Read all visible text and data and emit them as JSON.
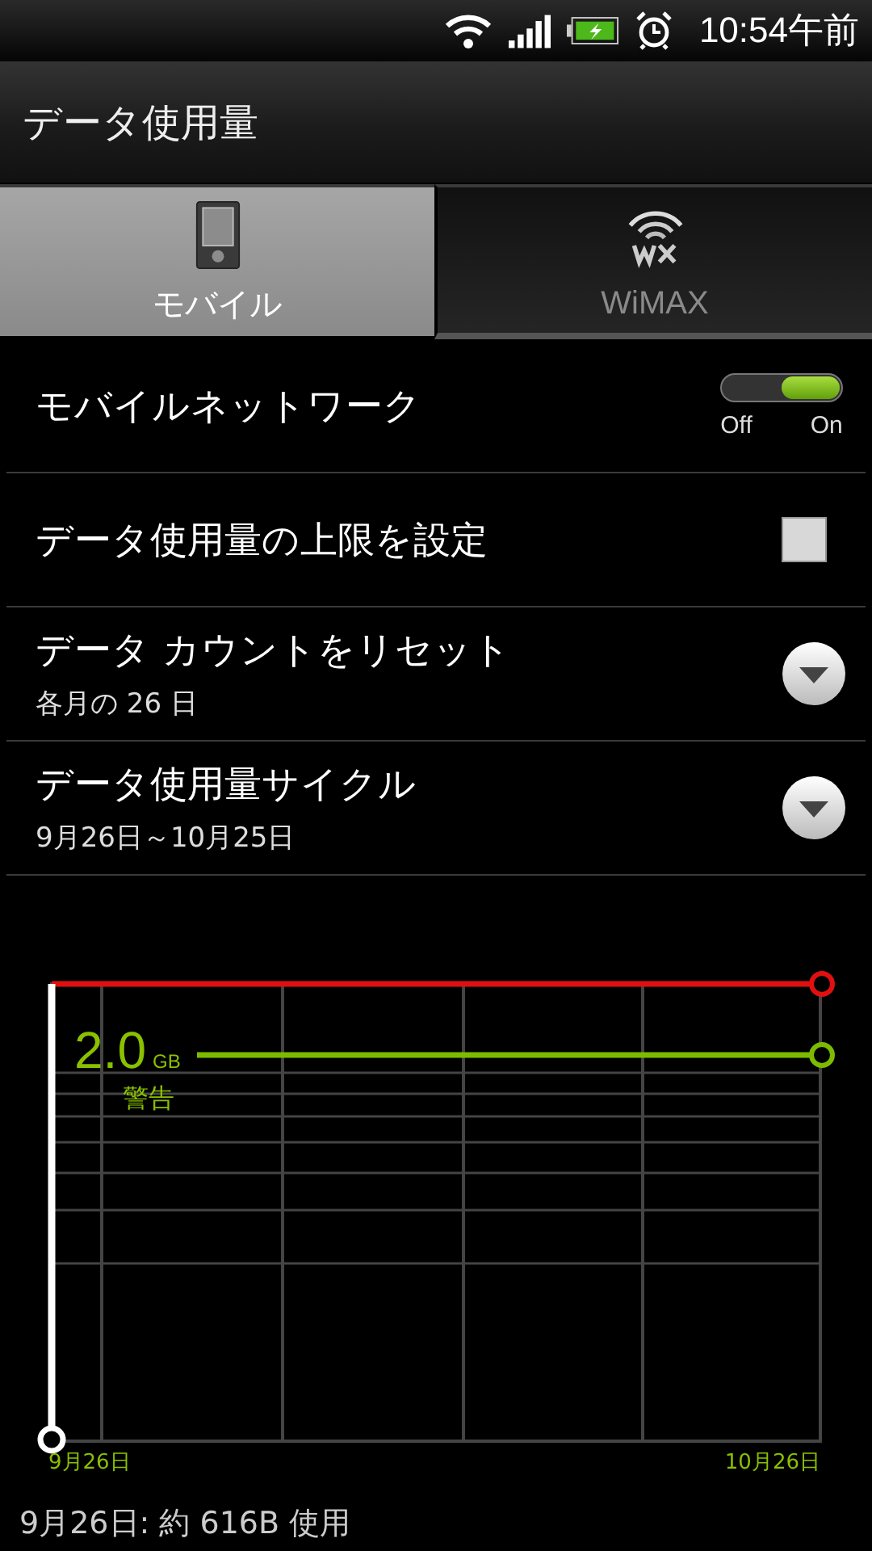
{
  "status_bar": {
    "time": "10:54午前"
  },
  "title": "データ使用量",
  "tabs": [
    {
      "label": "モバイル",
      "kind": "phone",
      "selected": true
    },
    {
      "label": "WiMAX",
      "kind": "wimax",
      "selected": false
    }
  ],
  "settings": [
    {
      "kind": "toggle",
      "title": "モバイルネットワーク",
      "on": true,
      "off_label": "Off",
      "on_label": "On"
    },
    {
      "kind": "checkbox",
      "title": "データ使用量の上限を設定",
      "checked": false
    },
    {
      "kind": "dropdown",
      "title": "データ カウントをリセット",
      "summary": "各月の 26 日"
    },
    {
      "kind": "dropdown",
      "title": "データ使用量サイクル",
      "summary": "9月26日～10月25日"
    }
  ],
  "usage_chart": {
    "warning_value": "2.0",
    "warning_unit": "GB",
    "warning_label": "警告",
    "start_date": "9月26日",
    "end_date": "10月26日"
  },
  "usage_summary": "9月26日: 約 616B 使用"
}
